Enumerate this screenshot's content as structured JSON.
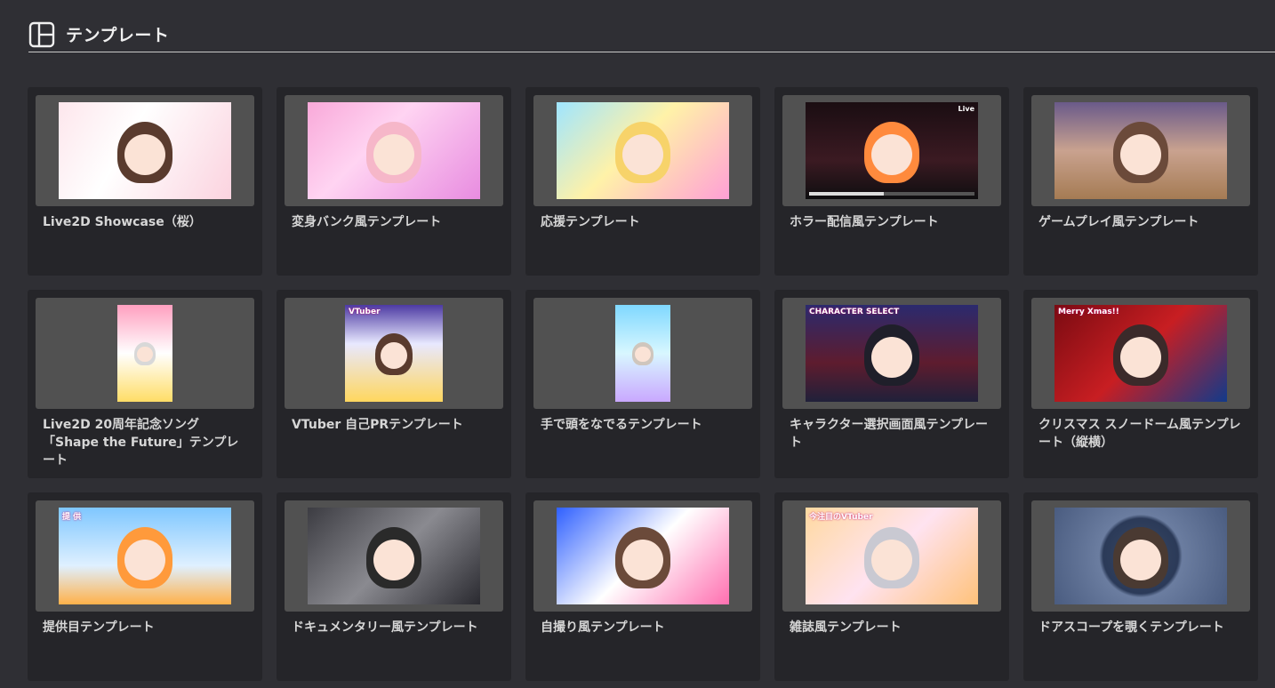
{
  "header": {
    "title": "テンプレート",
    "icon": "template-layout-icon"
  },
  "templates": [
    {
      "title": "Live2D Showcase（桜）",
      "thumb": "art-sakura",
      "shape": "wide",
      "caption": ""
    },
    {
      "title": "変身バンク風テンプレート",
      "thumb": "art-henshin",
      "shape": "wide",
      "caption": ""
    },
    {
      "title": "応援テンプレート",
      "thumb": "art-ouen",
      "shape": "wide",
      "caption": ""
    },
    {
      "title": "ホラー配信風テンプレート",
      "thumb": "art-horror",
      "shape": "wide",
      "caption": "Live"
    },
    {
      "title": "ゲームプレイ風テンプレート",
      "thumb": "art-game",
      "shape": "wide",
      "caption": ""
    },
    {
      "title": "Live2D 20周年記念ソング「Shape the Future」テンプレート",
      "thumb": "art-shape",
      "shape": "tall",
      "caption": ""
    },
    {
      "title": "VTuber 自己PRテンプレート",
      "thumb": "art-vtuber",
      "shape": "mid",
      "caption": "VTuber"
    },
    {
      "title": "手で頭をなでるテンプレート",
      "thumb": "art-nade",
      "shape": "tall",
      "caption": ""
    },
    {
      "title": "キャラクター選択画面風テンプレート",
      "thumb": "art-chara",
      "shape": "wide",
      "caption": "CHARACTER SELECT"
    },
    {
      "title": "クリスマス スノードーム風テンプレート（縦横）",
      "thumb": "art-xmas",
      "shape": "wide",
      "caption": "Merry Xmas!!"
    },
    {
      "title": "提供目テンプレート",
      "thumb": "art-teikyo",
      "shape": "wide",
      "caption": "提 供"
    },
    {
      "title": "ドキュメンタリー風テンプレート",
      "thumb": "art-docu",
      "shape": "wide",
      "caption": ""
    },
    {
      "title": "自撮り風テンプレート",
      "thumb": "art-jidori",
      "shape": "wide",
      "caption": ""
    },
    {
      "title": "雑誌風テンプレート",
      "thumb": "art-zasshi",
      "shape": "wide",
      "caption": "今注目のVTuber"
    },
    {
      "title": "ドアスコープを覗くテンプレート",
      "thumb": "art-door",
      "shape": "wide",
      "caption": ""
    }
  ]
}
